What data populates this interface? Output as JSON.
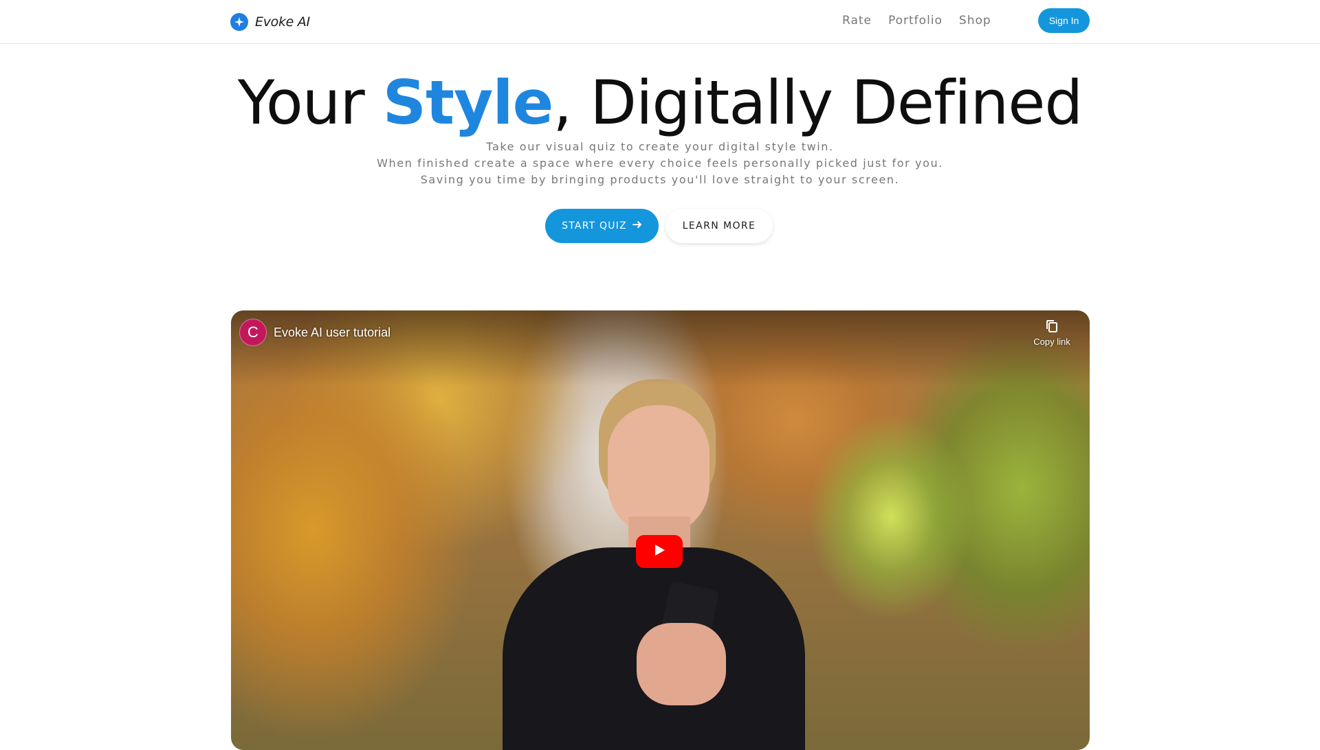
{
  "header": {
    "brand_name": "Evoke AI",
    "brand_icon": "sparkle-icon",
    "nav": [
      {
        "label": "Rate"
      },
      {
        "label": "Portfolio"
      },
      {
        "label": "Shop"
      }
    ],
    "sign_in_label": "Sign In"
  },
  "hero": {
    "title_before": "Your ",
    "title_accent": "Style",
    "title_after": ", Digitally Defined",
    "subtitle_lines": [
      "Take our visual quiz to create your digital style twin.",
      "When finished create a space where every choice feels personally picked just for you.",
      "Saving you time by bringing products you'll love straight to your screen."
    ],
    "start_quiz_label": "START QUIZ",
    "learn_more_label": "LEARN MORE"
  },
  "video": {
    "channel_initial": "C",
    "title": "Evoke AI user tutorial",
    "copy_link_label": "Copy link"
  },
  "colors": {
    "accent": "#1f86e0",
    "button": "#1496dc",
    "youtube_red": "#ff0000",
    "channel_avatar": "#c2185b"
  }
}
